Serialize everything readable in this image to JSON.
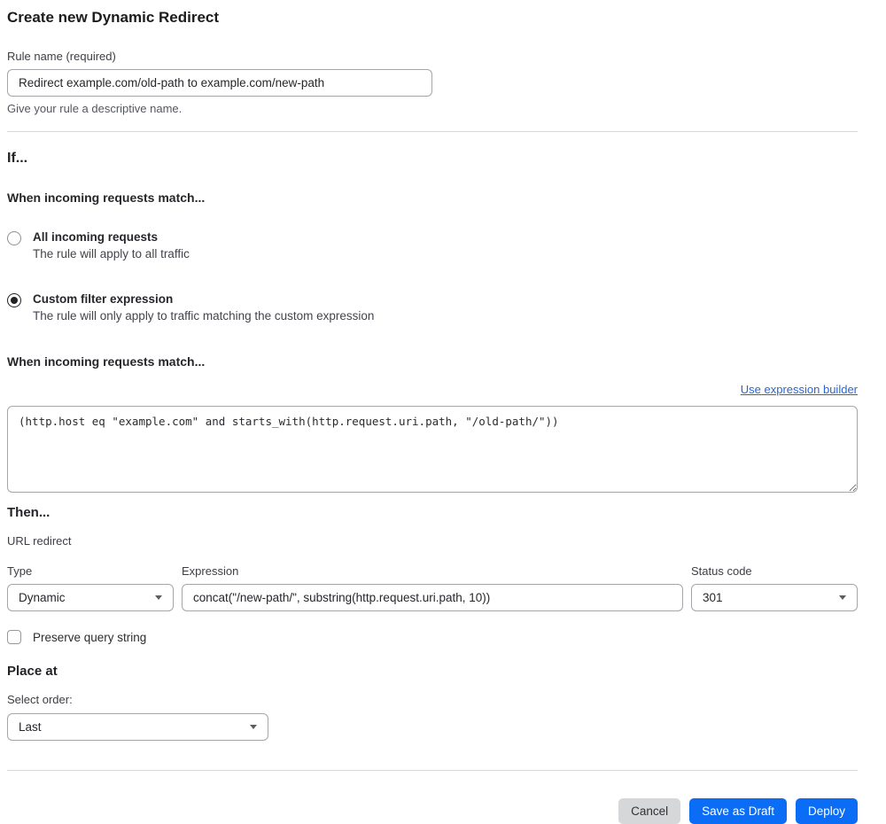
{
  "page": {
    "title": "Create new Dynamic Redirect"
  },
  "rule_name": {
    "label": "Rule name (required)",
    "value": "Redirect example.com/old-path to example.com/new-path",
    "help": "Give your rule a descriptive name."
  },
  "if_section": {
    "heading": "If...",
    "match_heading": "When incoming requests match...",
    "options": [
      {
        "label": "All incoming requests",
        "description": "The rule will apply to all traffic",
        "selected": false
      },
      {
        "label": "Custom filter expression",
        "description": "The rule will only apply to traffic matching the custom expression",
        "selected": true
      }
    ],
    "expression_heading": "When incoming requests match...",
    "builder_link": "Use expression builder",
    "expression_value": "(http.host eq \"example.com\" and starts_with(http.request.uri.path, \"/old-path/\"))"
  },
  "then_section": {
    "heading": "Then...",
    "action_label": "URL redirect",
    "type": {
      "label": "Type",
      "value": "Dynamic"
    },
    "expression": {
      "label": "Expression",
      "value": "concat(\"/new-path/\", substring(http.request.uri.path, 10))"
    },
    "status_code": {
      "label": "Status code",
      "value": "301"
    },
    "preserve_query_label": "Preserve query string",
    "preserve_query_checked": false
  },
  "place_at": {
    "heading": "Place at",
    "label": "Select order:",
    "value": "Last"
  },
  "footer": {
    "cancel_label": "Cancel",
    "save_draft_label": "Save as Draft",
    "deploy_label": "Deploy"
  },
  "colors": {
    "primary_button_blue": "#0b6df6",
    "link_blue": "#2b65cf",
    "cancel_button_gray": "#d6d7d8",
    "border_gray": "#a4a6aa",
    "divider_gray": "#d9dadb"
  }
}
